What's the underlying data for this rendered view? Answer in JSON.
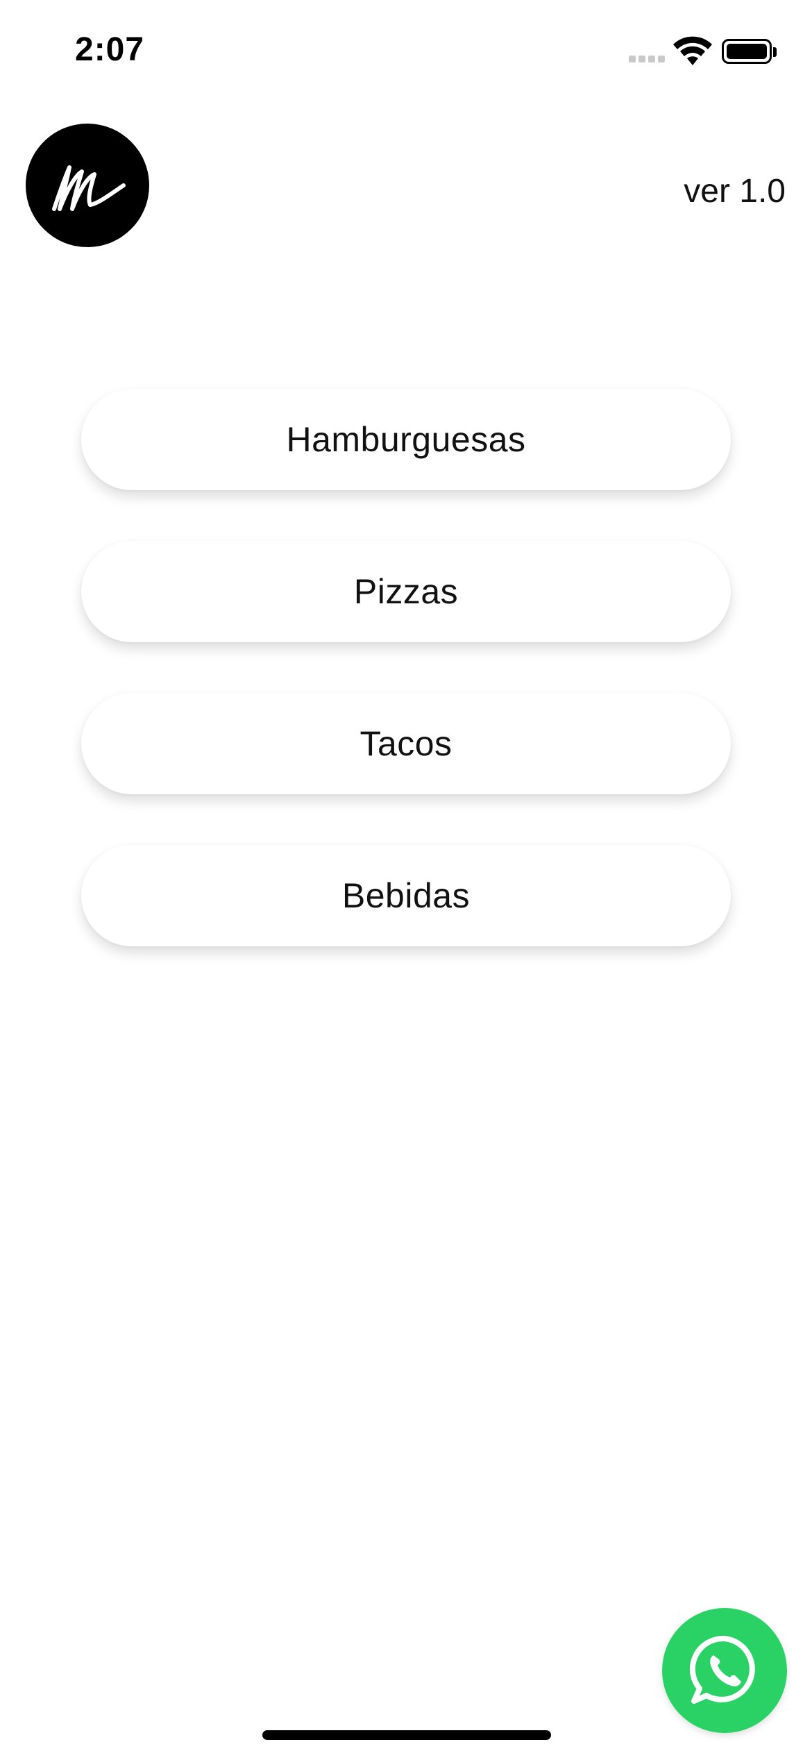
{
  "status_bar": {
    "time": "2:07",
    "signal_icon": "cellular-signal-icon",
    "wifi_icon": "wifi-icon",
    "battery_icon": "battery-icon",
    "battery_level": 1.0
  },
  "header": {
    "logo_icon": "m-script-logo",
    "version": "ver 1.0"
  },
  "menu": {
    "items": [
      {
        "label": "Hamburguesas"
      },
      {
        "label": "Pizzas"
      },
      {
        "label": "Tacos"
      },
      {
        "label": "Bebidas"
      }
    ]
  },
  "fab": {
    "icon": "whatsapp-icon",
    "color": "#2ad266"
  }
}
